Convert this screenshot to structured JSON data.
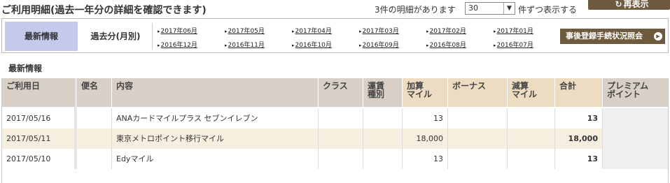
{
  "header": {
    "title": "ご利用明細(過去一年分の詳細を確認できます)",
    "count_text": "3件の明細があります",
    "per_page_value": "30",
    "per_page_suffix": "件ずつ表示する",
    "redisplay_label": "再表示"
  },
  "period": {
    "latest_tab": "最新情報",
    "past_tab": "過去分(月別)",
    "months_row1": [
      "2017年06月",
      "2017年05月",
      "2017年04月",
      "2017年03月",
      "2017年02月",
      "2017年01月"
    ],
    "months_row2": [
      "2016年12月",
      "2016年11月",
      "2016年10月",
      "2016年09月",
      "2016年08月",
      "2016年07月"
    ],
    "post_registration_button": "事後登録手続状況照会"
  },
  "section_label": "最新情報",
  "table": {
    "headers": {
      "date": "ご利用日",
      "flight": "便名",
      "content": "内容",
      "class": "クラス",
      "fare_type": "運賃\n種別",
      "added_miles": "加算\nマイル",
      "bonus": "ボーナス",
      "deducted_miles": "減算\nマイル",
      "total": "合計",
      "premium_points": "プレミアム\nポイント"
    },
    "rows": [
      {
        "date": "2017/05/16",
        "flight": "",
        "content": "ANAカードマイルプラス セブンイレブン",
        "class": "",
        "fare_type": "",
        "added_miles": "13",
        "bonus": "",
        "deducted_miles": "",
        "total": "13",
        "premium_points": ""
      },
      {
        "date": "2017/05/11",
        "flight": "",
        "content": "東京メトロポイント移行マイル",
        "class": "",
        "fare_type": "",
        "added_miles": "18,000",
        "bonus": "",
        "deducted_miles": "",
        "total": "18,000",
        "premium_points": ""
      },
      {
        "date": "2017/05/10",
        "flight": "",
        "content": "Edyマイル",
        "class": "",
        "fare_type": "",
        "added_miles": "13",
        "bonus": "",
        "deducted_miles": "",
        "total": "13",
        "premium_points": ""
      }
    ]
  }
}
